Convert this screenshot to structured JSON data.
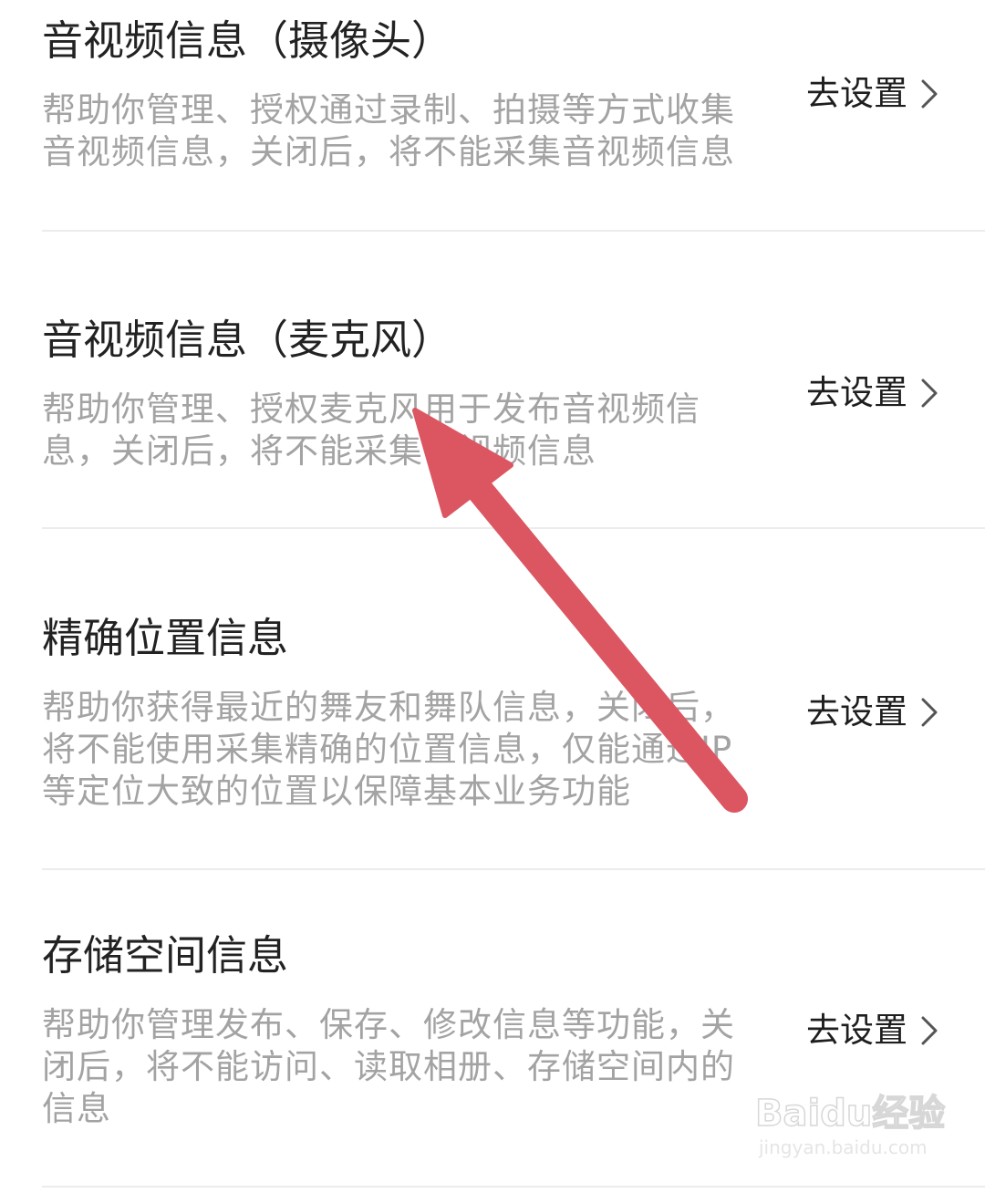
{
  "items": [
    {
      "title": "音视频信息（摄像头）",
      "desc_lines": [
        "帮助你管理、授权通过录制、拍摄等方式收集",
        "音视频信息，关闭后，将不能采集音视频信息"
      ],
      "action_label": "去设置"
    },
    {
      "title": "音视频信息（麦克风）",
      "desc_lines": [
        "帮助你管理、授权麦克风用于发布音视频信",
        "息，关闭后，将不能采集音视频信息"
      ],
      "action_label": "去设置"
    },
    {
      "title": "精确位置信息",
      "desc_lines": [
        "帮助你获得最近的舞友和舞队信息，关闭后，",
        "将不能使用采集精确的位置信息，仅能通过IP",
        "等定位大致的位置以保障基本业务功能"
      ],
      "action_label": "去设置"
    },
    {
      "title": "存储空间信息",
      "desc_lines": [
        "帮助你管理发布、保存、修改信息等功能，关",
        "闭后，将不能访问、读取相册、存储空间内的",
        "信息"
      ],
      "action_label": "去设置"
    }
  ],
  "watermark": {
    "logo_text": "Baidu经验",
    "url": "jingyan.baidu.com"
  },
  "colors": {
    "arrow": "#dc5662",
    "title": "#222222",
    "desc": "#a3a3a3",
    "divider": "#ececec"
  },
  "icons": {
    "chevron": "chevron-right-icon",
    "annotation": "annotation-arrow-icon"
  }
}
